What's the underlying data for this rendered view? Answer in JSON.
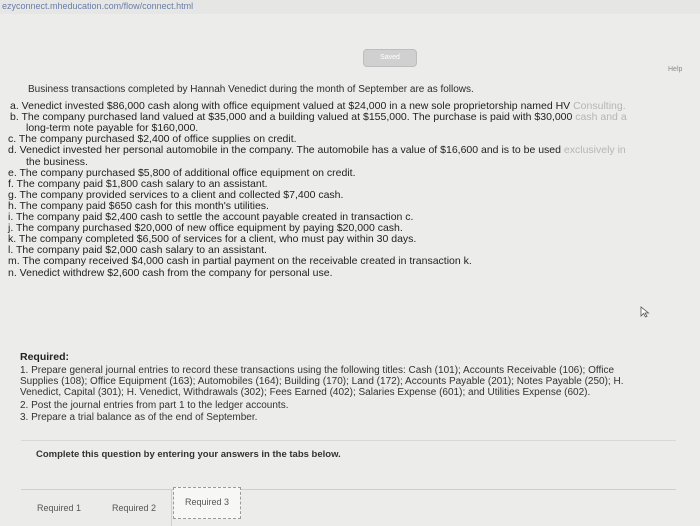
{
  "browser": {
    "url": "ezyconnect.mheducation.com/flow/connect.html"
  },
  "toolbar": {
    "saved_label": "Saved",
    "help_label": "Help"
  },
  "problem": {
    "title": "Business transactions completed by Hannah Venedict during the month of September are as follows.",
    "items": [
      {
        "line1": "a. Venedict invested $86,000 cash along with office equipment valued at $24,000 in a new sole proprietorship named HV ",
        "fade1": "Consulting."
      },
      {
        "line1": "b. The company purchased land valued at $35,000 and a building valued at $155,000. The purchase is paid with $30,000 ",
        "fade1": "cash and a",
        "line2": "long-term note payable for $160,000."
      },
      {
        "line1": "c. The company purchased $2,400 of office supplies on credit."
      },
      {
        "line1": "d. Venedict invested her personal automobile in the company. The automobile has a value of $16,600 and is to be used ",
        "fade1": "exclusively in",
        "line2": "the business."
      },
      {
        "line1": "e. The company purchased $5,800 of additional office equipment on credit."
      },
      {
        "line1": "f. The company paid $1,800 cash salary to an assistant."
      },
      {
        "line1": "g. The company provided services to a client and collected $7,400 cash."
      },
      {
        "line1": "h. The company paid $650 cash for this month's utilities."
      },
      {
        "line1": "i. The company paid $2,400 cash to settle the account payable created in transaction c."
      },
      {
        "line1": "j. The company purchased $20,000 of new office equipment by paying $20,000 cash."
      },
      {
        "line1": "k. The company completed $6,500 of services for a client, who must pay within 30 days."
      },
      {
        "line1": "l. The company paid $2,000 cash salary to an assistant."
      },
      {
        "line1": "m. The company received $4,000 cash in partial payment on the receivable created in transaction k."
      },
      {
        "line1": "n. Venedict withdrew $2,600 cash from the company for personal use."
      }
    ]
  },
  "required": {
    "heading": "Required:",
    "lines": [
      "1. Prepare general journal entries to record these transactions using the following titles: Cash (101); Accounts Receivable (106); Office",
      "Supplies (108); Office Equipment (163); Automobiles (164); Building (170); Land (172); Accounts Payable (201); Notes Payable (250); H.",
      "Venedict, Capital (301); H. Venedict, Withdrawals (302); Fees Earned (402); Salaries Expense (601); and Utilities Expense (602).",
      "2. Post the journal entries from part 1 to the ledger accounts.",
      "3. Prepare a trial balance as of the end of September."
    ]
  },
  "instructions": {
    "text": "Complete this question by entering your answers in the tabs below."
  },
  "tabs": [
    {
      "label": "Required 1"
    },
    {
      "label": "Required 2"
    },
    {
      "label": "Required 3"
    }
  ]
}
